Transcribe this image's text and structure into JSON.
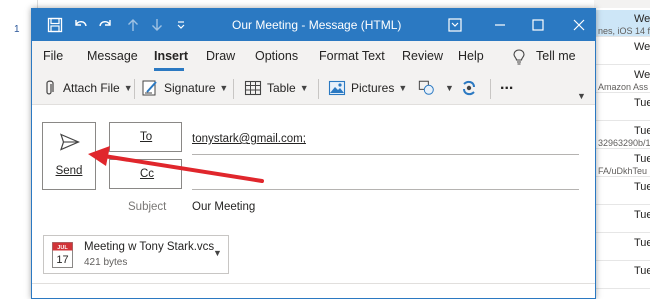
{
  "background": {
    "row_number": "1",
    "rows": [
      {
        "line1": "We",
        "line2": "nes, iOS 14 f",
        "selected": true
      },
      {
        "line1": "We",
        "line2": ""
      },
      {
        "line1": "We",
        "line2": "Amazon Ass"
      },
      {
        "line1": "Tue",
        "line2": ""
      },
      {
        "line1": "Tue",
        "line2": "32963290b/1"
      },
      {
        "line1": "Tue",
        "line2": "FA/uDkhTeu"
      },
      {
        "line1": "Tue",
        "line2": ""
      },
      {
        "line1": "Tue",
        "line2": ""
      },
      {
        "line1": "Tue",
        "line2": ""
      },
      {
        "line1": "Tue",
        "line2": ""
      }
    ]
  },
  "window": {
    "title": "Our Meeting  -  Message (HTML)",
    "icons": [
      "save-icon",
      "undo-icon",
      "redo-icon",
      "up-arrow-icon",
      "down-arrow-icon",
      "customize-icon",
      "ribbon-display-icon",
      "minimize-icon",
      "maximize-icon",
      "close-icon"
    ]
  },
  "menu": {
    "items": [
      "File",
      "Message",
      "Insert",
      "Draw",
      "Options",
      "Format Text",
      "Review",
      "Help",
      "Tell me"
    ],
    "active": "Insert"
  },
  "ribbon": {
    "attach_file": "Attach File",
    "signature": "Signature",
    "table": "Table",
    "pictures": "Pictures",
    "more": "..."
  },
  "compose": {
    "send_label": "Send",
    "to_label": "To",
    "cc_label": "Cc",
    "to_value": "tonystark@gmail.com;",
    "cc_value": "",
    "subject_label": "Subject",
    "subject_value": "Our Meeting"
  },
  "attachment": {
    "name": "Meeting w Tony Stark.vcs",
    "size": "421 bytes",
    "calendar_month": "JUL",
    "calendar_day": "17"
  },
  "colors": {
    "accent": "#2b79c2",
    "annotation_arrow": "#e0262c"
  }
}
